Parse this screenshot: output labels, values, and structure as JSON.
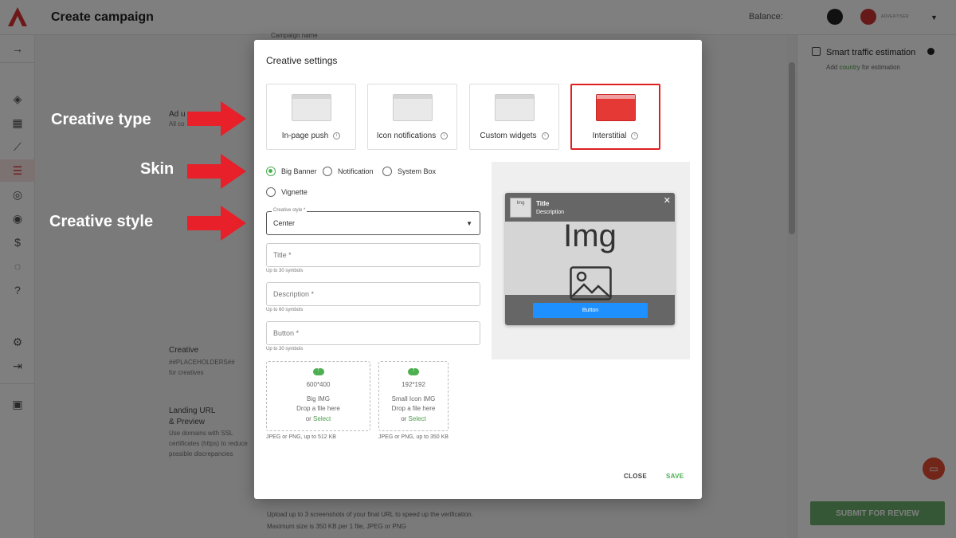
{
  "app": {
    "page_title": "Create campaign",
    "balance_label": "Balance:",
    "role": "ADVERTISER"
  },
  "background": {
    "top_field_text": "Campaign name",
    "ad_unit_label": "Ad u",
    "ad_unit_sub": "All co",
    "creative_label": "Creative",
    "creative_placeholder": "##PLACEHOLDERS##",
    "creative_sub": "for creatives",
    "landing_label_1": "Landing URL",
    "landing_label_2": "& Preview",
    "landing_sub_1": "Use domains with SSL",
    "landing_sub_2": "certificates (https) to reduce",
    "landing_sub_3": "possible discrepancies",
    "screens_note": "Upload up to 3 screenshots of your final URL to speed up the verification.",
    "screens_note_2": "Maximum size is 350 KB per 1 file, JPEG or PNG"
  },
  "right_panel": {
    "title": "Smart traffic estimation",
    "sub_prefix": "Add ",
    "sub_link": "country",
    "sub_suffix": " for estimation",
    "submit_label": "SUBMIT FOR REVIEW"
  },
  "annotations": {
    "creative_type": "Creative type",
    "skin": "Skin",
    "creative_style": "Creative style",
    "arrow_color": "#e8202a"
  },
  "modal": {
    "title": "Creative settings",
    "types": [
      {
        "label": "In-page push"
      },
      {
        "label": "Icon notifications"
      },
      {
        "label": "Custom widgets"
      },
      {
        "label": "Interstitial"
      }
    ],
    "skins": [
      "Big Banner",
      "Notification",
      "System Box",
      "Vignette"
    ],
    "style_label": "Creative style *",
    "style_value": "Center",
    "title_placeholder": "Title *",
    "title_hint": "Up to 30 symbols",
    "desc_placeholder": "Description *",
    "desc_hint": "Up to 60 symbols",
    "button_placeholder": "Button *",
    "button_hint": "Up to 30 symbols",
    "big_img": {
      "size": "600*400",
      "name": "Big IMG",
      "drop": "Drop a file here",
      "or": "or ",
      "select": "Select",
      "note": "JPEG or PNG, up to 512 KB"
    },
    "small_img": {
      "size": "192*192",
      "name": "Small Icon IMG",
      "drop": "Drop a file here",
      "or": "or ",
      "select": "Select",
      "note": "JPEG or PNG, up to 350 KB"
    },
    "preview": {
      "icon_text": "Img",
      "title": "Title",
      "description": "Description",
      "img_text": "Img",
      "button": "Button"
    },
    "close_label": "CLOSE",
    "save_label": "SAVE"
  }
}
